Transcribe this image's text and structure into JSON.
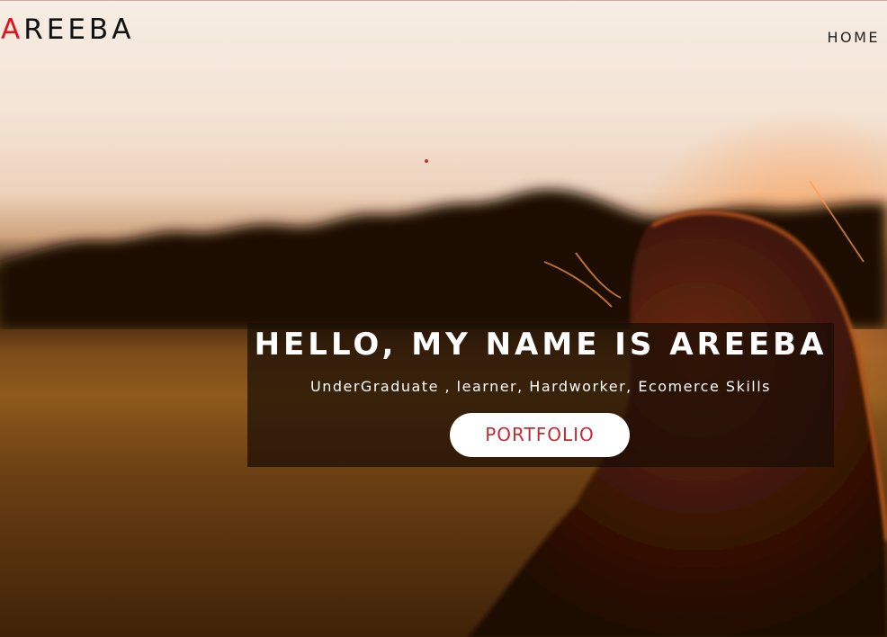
{
  "header": {
    "logo_first_letter": "A",
    "logo_rest": "REEBA",
    "nav": {
      "home_label": "HOME"
    }
  },
  "hero": {
    "title": "HELLO, MY NAME IS AREEBA",
    "subtitle": "UnderGraduate , learner, Hardworker, Ecomerce Skills",
    "button_label": "PORTFOLIO"
  },
  "colors": {
    "accent_red": "#e0131d",
    "button_text": "#c62b33",
    "button_bg": "#ffffff",
    "overlay": "rgba(25,12,4,0.72)"
  }
}
